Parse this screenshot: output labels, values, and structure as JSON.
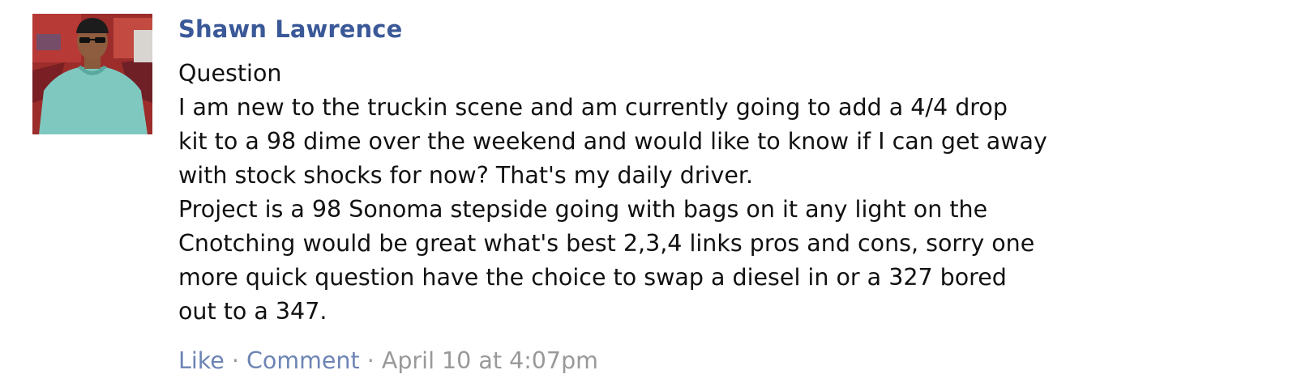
{
  "post": {
    "author": "Shawn Lawrence",
    "message_lines": [
      "Question",
      "I am new to the truckin scene and am currently going to add a 4/4 drop",
      "kit to a 98 dime over the weekend and would like to know if I can get away",
      "with stock shocks for now? That's my daily driver.",
      "Project is a 98 Sonoma stepside going with bags on it any light on the",
      "Cnotching would be great what's best 2,3,4 links pros and cons, sorry one",
      "more quick question have the choice to swap a diesel in or a 327 bored",
      "out to a 347."
    ],
    "actions": {
      "like_label": "Like",
      "comment_label": "Comment",
      "separator": " · ",
      "timestamp": "April 10 at 4:07pm"
    },
    "colors": {
      "author_link": "#3b5998",
      "action_link": "#6d84b4",
      "timestamp": "#999999",
      "text": "#111111"
    },
    "avatar_icon": "profile-photo"
  }
}
